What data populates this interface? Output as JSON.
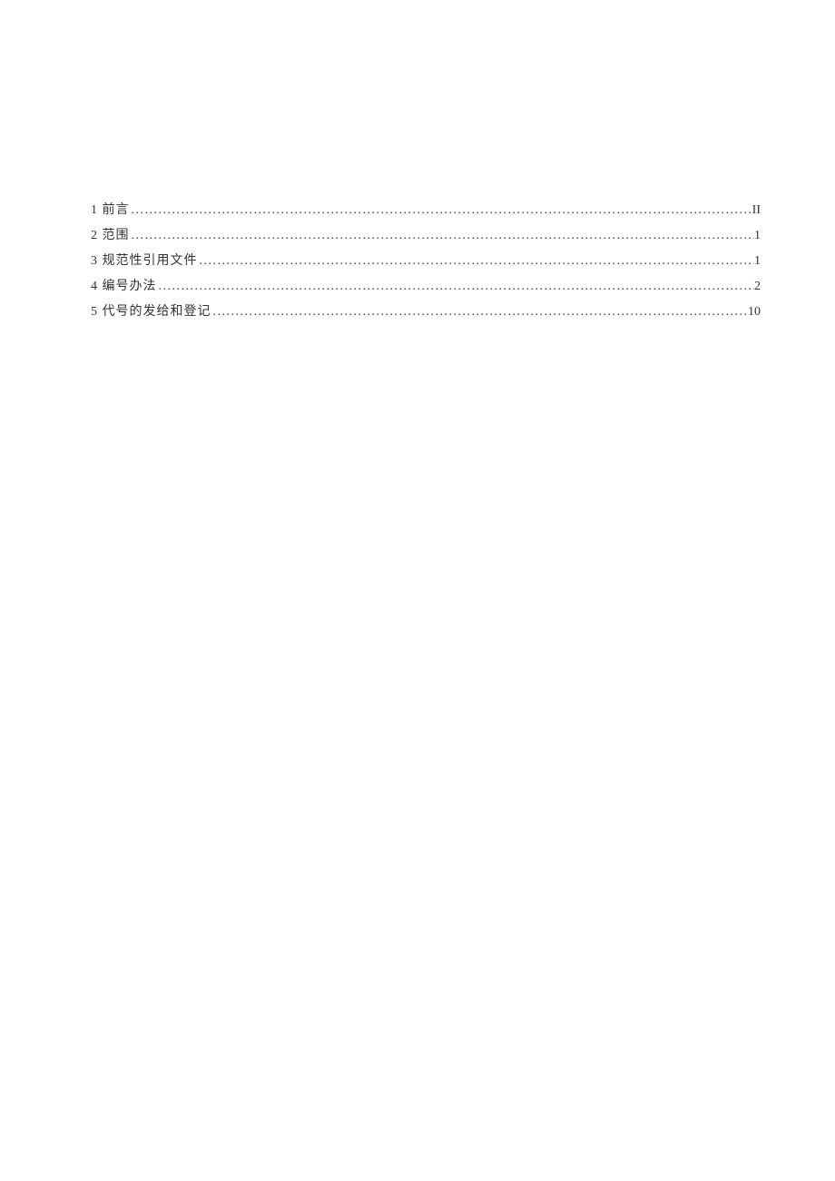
{
  "toc": {
    "entries": [
      {
        "num": "1",
        "title": "前言",
        "page": "II"
      },
      {
        "num": "2",
        "title": "范围",
        "page": "1"
      },
      {
        "num": "3",
        "title": "规范性引用文件",
        "page": "1"
      },
      {
        "num": "4",
        "title": "编号办法",
        "page": "2"
      },
      {
        "num": "5",
        "title": "代号的发给和登记",
        "page": "10"
      }
    ]
  }
}
